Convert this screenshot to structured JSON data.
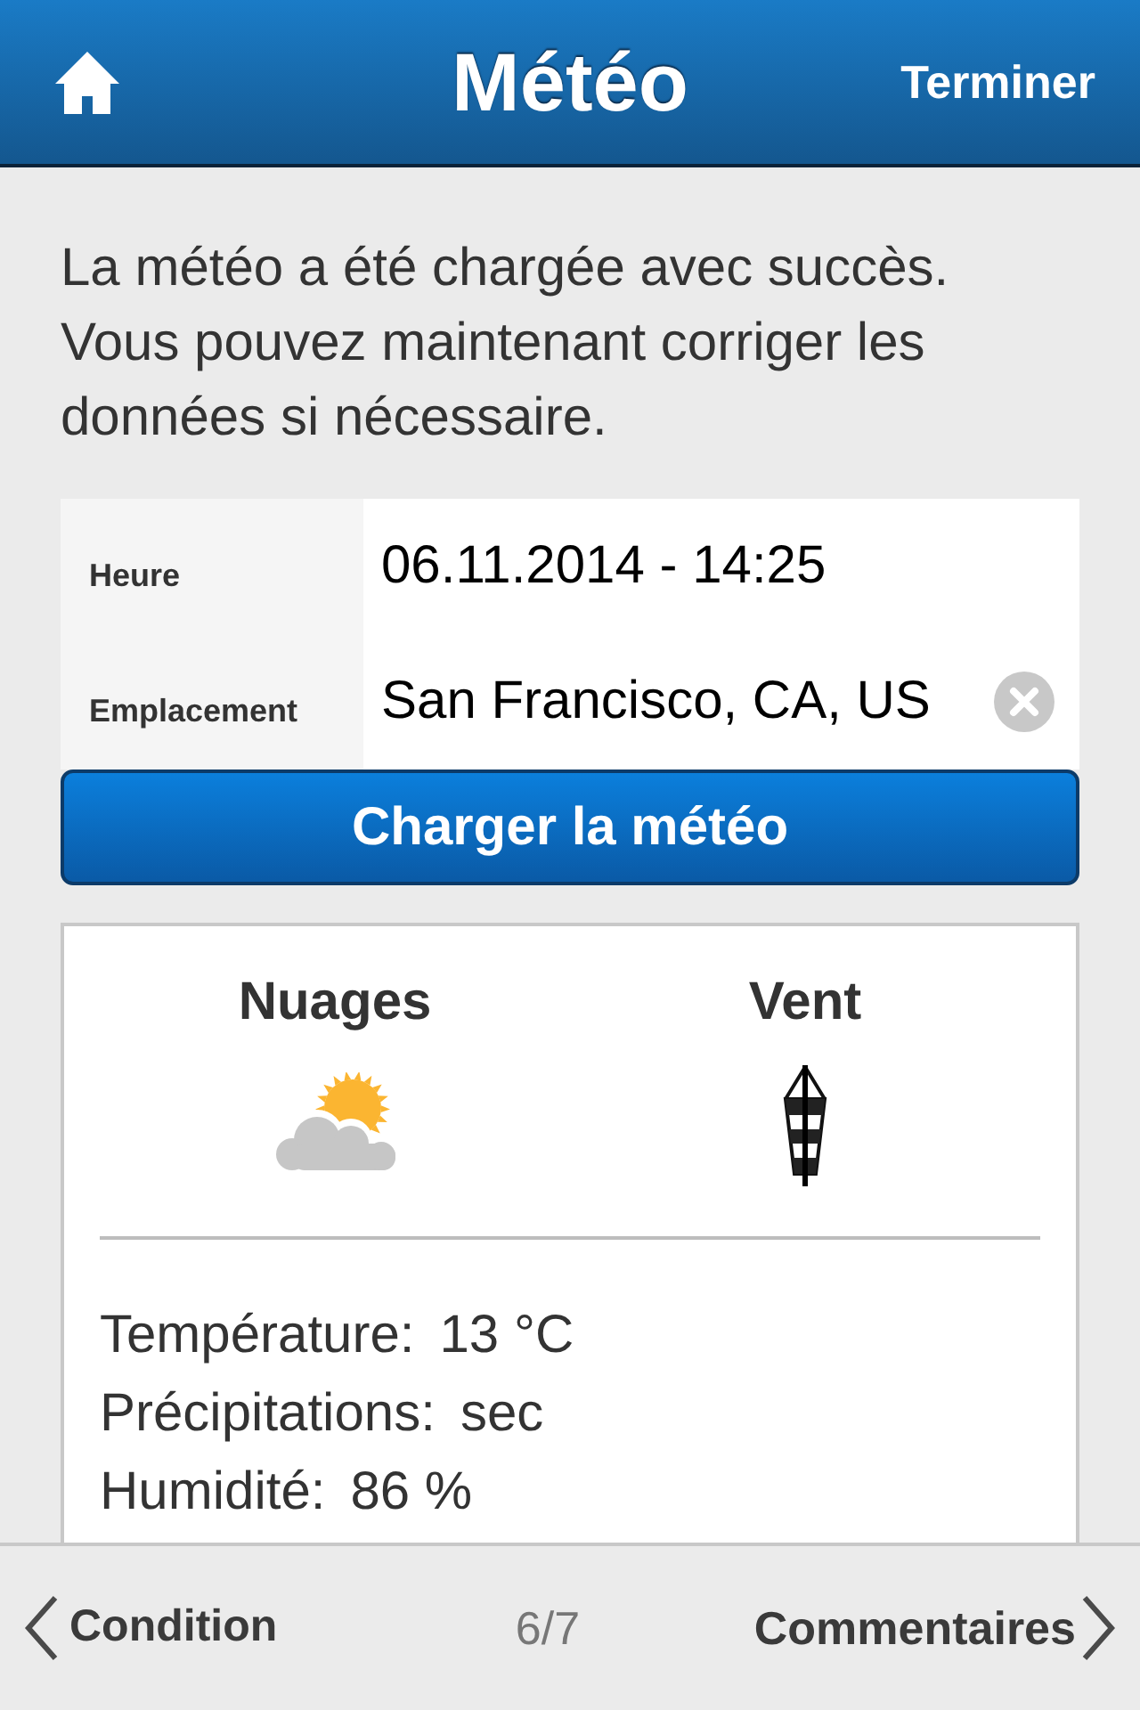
{
  "nav_bar": {
    "title": "Météo",
    "done_button": "Terminer"
  },
  "message": "La météo a été chargée avec succès. Vous pouvez maintenant corriger les données si nécessaire.",
  "form": [
    {
      "label": "Heure",
      "value": "06.11.2014 - 14:25",
      "kind": "text"
    },
    {
      "label": "Emplacement",
      "value": "San Francisco, CA, US",
      "kind": "clearable"
    }
  ],
  "load_button": "Charger la météo",
  "weather": {
    "columns": [
      {
        "heading": "Nuages",
        "kind": "clouds"
      },
      {
        "heading": "Vent",
        "kind": "windsock"
      }
    ],
    "details": [
      {
        "label": "Température:",
        "value": "13 °C"
      },
      {
        "label": "Précipitations:",
        "value": "sec"
      },
      {
        "label": "Humidité:",
        "value": "86 %"
      }
    ]
  },
  "footer": {
    "previous": "Condition",
    "page": "6/7",
    "next": "Commentaires"
  }
}
